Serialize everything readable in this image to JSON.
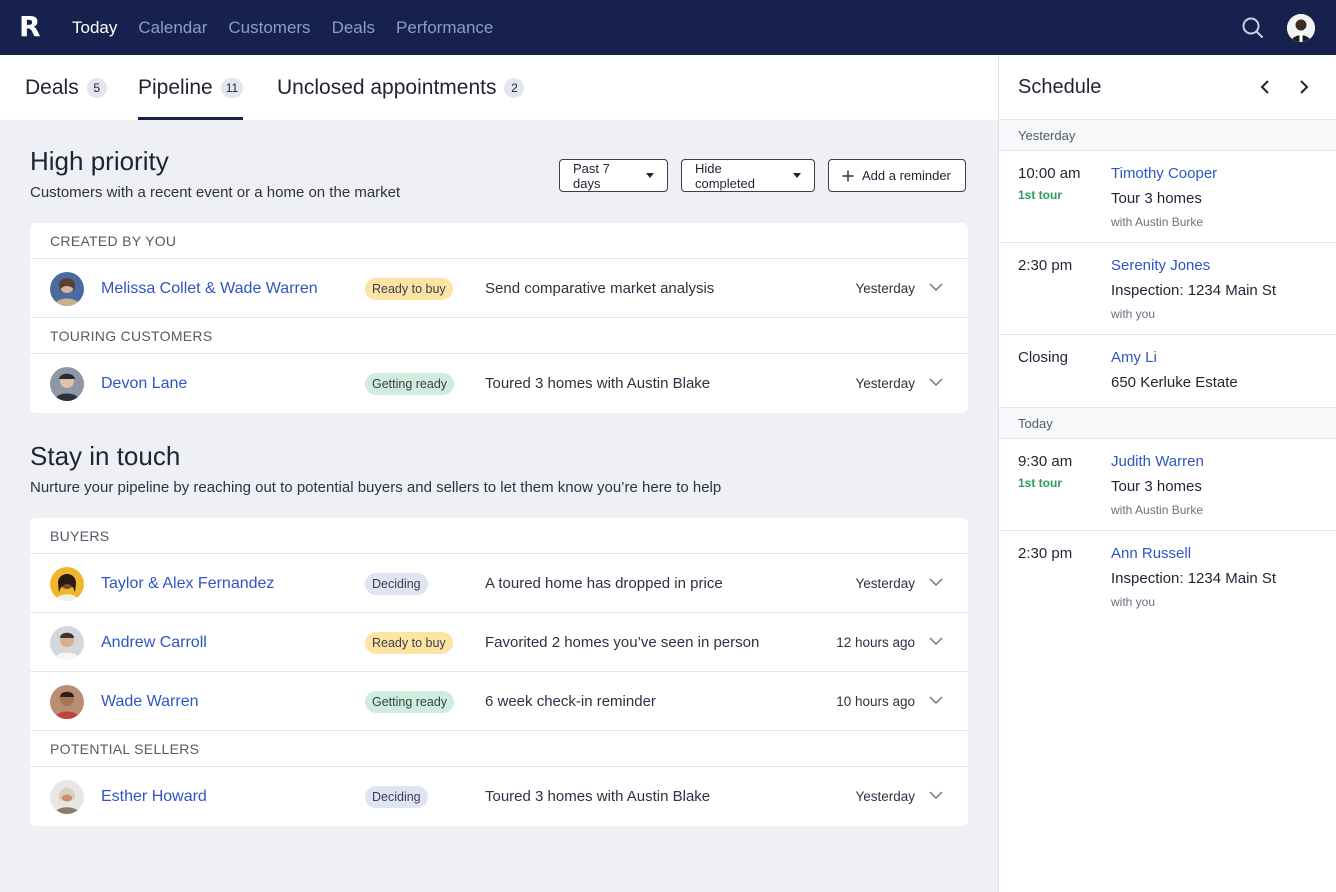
{
  "app": {
    "logo_letter": "R"
  },
  "nav": {
    "items": [
      {
        "label": "Today",
        "active": true
      },
      {
        "label": "Calendar",
        "active": false
      },
      {
        "label": "Customers",
        "active": false
      },
      {
        "label": "Deals",
        "active": false
      },
      {
        "label": "Performance",
        "active": false
      }
    ],
    "search_icon": "search-icon",
    "avatar": "user-avatar"
  },
  "tabs": [
    {
      "label": "Deals",
      "count": "5",
      "active": false
    },
    {
      "label": "Pipeline",
      "count": "11",
      "active": true
    },
    {
      "label": "Unclosed appointments",
      "count": "2",
      "active": false
    }
  ],
  "high_priority": {
    "title": "High priority",
    "subtitle": "Customers with a recent event or a home on the market",
    "filter_period": "Past 7 days",
    "filter_completed": "Hide completed",
    "add_reminder": "Add a reminder",
    "groups": [
      {
        "label": "CREATED BY YOU",
        "rows": [
          {
            "name": "Melissa Collet & Wade Warren",
            "status": "Ready to buy",
            "status_type": "ready",
            "desc": "Send comparative market analysis",
            "time": "Yesterday"
          }
        ]
      },
      {
        "label": "TOURING CUSTOMERS",
        "rows": [
          {
            "name": "Devon Lane",
            "status": "Getting ready",
            "status_type": "getting",
            "desc": "Toured 3 homes with Austin Blake",
            "time": "Yesterday"
          }
        ]
      }
    ]
  },
  "stay_in_touch": {
    "title": "Stay in touch",
    "subtitle": "Nurture your pipeline by reaching out to potential buyers and sellers to let them know you’re here to help",
    "groups": [
      {
        "label": "BUYERS",
        "rows": [
          {
            "name": "Taylor & Alex Fernandez",
            "status": "Deciding",
            "status_type": "deciding",
            "desc": "A toured home has dropped in price",
            "time": "Yesterday"
          },
          {
            "name": "Andrew Carroll",
            "status": "Ready to buy",
            "status_type": "ready",
            "desc": "Favorited 2 homes you’ve seen in person",
            "time": "12 hours ago"
          },
          {
            "name": "Wade Warren",
            "status": "Getting ready",
            "status_type": "getting",
            "desc": "6 week check-in reminder",
            "time": "10 hours ago"
          }
        ]
      },
      {
        "label": "POTENTIAL SELLERS",
        "rows": [
          {
            "name": "Esther Howard",
            "status": "Deciding",
            "status_type": "deciding",
            "desc": "Toured 3 homes with Austin Blake",
            "time": "Yesterday"
          }
        ]
      }
    ]
  },
  "schedule": {
    "title": "Schedule",
    "days": [
      {
        "label": "Yesterday",
        "events": [
          {
            "time": "10:00 am",
            "tag": "1st tour",
            "name": "Timothy Cooper",
            "desc": "Tour 3 homes",
            "with": "with Austin Burke"
          },
          {
            "time": "2:30 pm",
            "tag": "",
            "name": "Serenity Jones",
            "desc": "Inspection: 1234 Main St",
            "with": "with you"
          },
          {
            "time": "Closing",
            "tag": "",
            "name": "Amy Li",
            "desc": "650 Kerluke Estate",
            "with": ""
          }
        ]
      },
      {
        "label": "Today",
        "events": [
          {
            "time": "9:30 am",
            "tag": "1st tour",
            "name": "Judith Warren",
            "desc": "Tour 3 homes",
            "with": "with Austin Burke"
          },
          {
            "time": "2:30 pm",
            "tag": "",
            "name": "Ann Russell",
            "desc": "Inspection: 1234 Main St",
            "with": "with you"
          }
        ]
      }
    ]
  },
  "colors": {
    "nav_bg": "#16224d",
    "link": "#2f55c4",
    "ready": "#fde3a4",
    "getting": "#cfecdc",
    "deciding": "#dfe3f3",
    "tour_tag": "#2f9a64"
  }
}
